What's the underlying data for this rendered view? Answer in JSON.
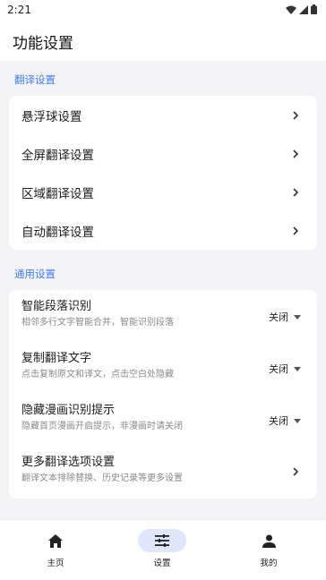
{
  "status": {
    "time": "2:21"
  },
  "header": {
    "title": "功能设置"
  },
  "sections": {
    "translate": {
      "label": "翻译设置",
      "items": [
        {
          "label": "悬浮球设置"
        },
        {
          "label": "全屏翻译设置"
        },
        {
          "label": "区域翻译设置"
        },
        {
          "label": "自动翻译设置"
        }
      ]
    },
    "general": {
      "label": "通用设置",
      "items": [
        {
          "title": "智能段落识别",
          "subtitle": "相邻多行文字智能合并，智能识别段落",
          "value": "关闭"
        },
        {
          "title": "复制翻译文字",
          "subtitle": "点击复制原文和译文，点击空白处隐藏",
          "value": "关闭"
        },
        {
          "title": "隐藏漫画识别提示",
          "subtitle": "隐藏首页漫画开启提示，非漫画时请关闭",
          "value": "关闭"
        },
        {
          "title": "更多翻译选项设置",
          "subtitle": "翻译文本排除替换、历史记录等更多设置"
        }
      ]
    }
  },
  "nav": {
    "items": [
      {
        "label": "主页",
        "icon": "home-icon"
      },
      {
        "label": "设置",
        "icon": "sliders-icon",
        "active": true
      },
      {
        "label": "我的",
        "icon": "person-icon"
      }
    ]
  },
  "colors": {
    "accent": "#3f7ef0",
    "active_pill": "#dfe8fb"
  }
}
